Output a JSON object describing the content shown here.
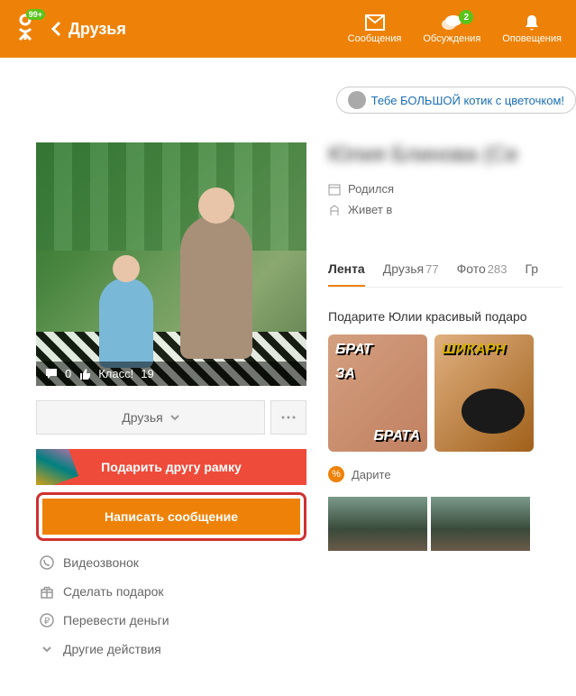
{
  "header": {
    "badge": "99+",
    "title": "Друзья",
    "messages": "Сообщения",
    "discussions": "Обсуждения",
    "discussions_badge": "2",
    "notifications": "Оповещения"
  },
  "promo": {
    "text": "Тебе БОЛЬШОЙ котик с цветочком!"
  },
  "photo": {
    "comments": "0",
    "likes_label": "Класс!",
    "likes_count": "19"
  },
  "sidebar": {
    "friends_dropdown": "Друзья",
    "gift_frame": "Подарить другу рамку",
    "write_message": "Написать сообщение",
    "actions": [
      "Видеозвонок",
      "Сделать подарок",
      "Перевести деньги",
      "Другие действия"
    ]
  },
  "profile": {
    "name": "Юлия Блинова (Се",
    "born_label": "Родился",
    "lives_label": "Живет в"
  },
  "tabs": {
    "feed": "Лента",
    "friends": "Друзья",
    "friends_count": "77",
    "photos": "Фото",
    "photos_count": "283",
    "groups": "Гр"
  },
  "gifts": {
    "title": "Подарите Юлии красивый подаро",
    "item1_top": "БРАТ",
    "item1_mid": "ЗА",
    "item1_bot": "БРАТА",
    "item2_label": "ШИКАРН",
    "give_label": "Дарите"
  }
}
